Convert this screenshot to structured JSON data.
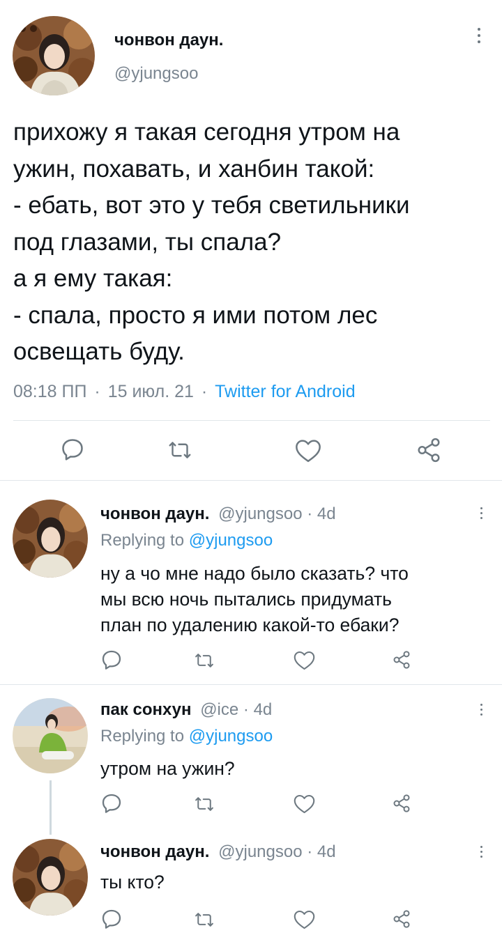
{
  "main_tweet": {
    "display_name": "чонвон даун.",
    "handle": "@yjungsoo",
    "lines": [
      "прихожу я такая сегодня утром на",
      "ужин, похавать, и ханбин такой:",
      "- ебать, вот это у тебя светильники",
      "под глазами, ты спала?",
      "а я ему такая:",
      "- спала, просто я ими потом лес",
      "освещать буду."
    ],
    "time": "08:18 ПП",
    "date": "15 июл. 21",
    "separator": "·",
    "source": "Twitter for Android"
  },
  "replies": [
    {
      "display_name": "чонвон даун.",
      "handle": "@yjungsoo",
      "age": "4d",
      "replying_to_label": "Replying to",
      "replying_to_handle": "@yjungsoo",
      "lines": [
        "ну а чо мне надо было сказать? что",
        "мы всю ночь пытались придумать",
        "план по удалению какой-то ебаки?"
      ]
    },
    {
      "display_name": "пак сонхун",
      "handle": "@ice",
      "age": "4d",
      "replying_to_label": "Replying to",
      "replying_to_handle": "@yjungsoo",
      "lines": [
        "утром на ужин?"
      ]
    },
    {
      "display_name": "чонвон даун.",
      "handle": "@yjungsoo",
      "age": "4d",
      "lines": [
        "ты кто?"
      ]
    }
  ],
  "colors": {
    "accent": "#1d9bf0",
    "secondary_text": "#7a8590",
    "icon": "#6d7880",
    "divider": "#e1e6ea"
  },
  "icons": [
    "more-vertical-icon",
    "reply-icon",
    "retweet-icon",
    "like-icon",
    "share-icon"
  ]
}
